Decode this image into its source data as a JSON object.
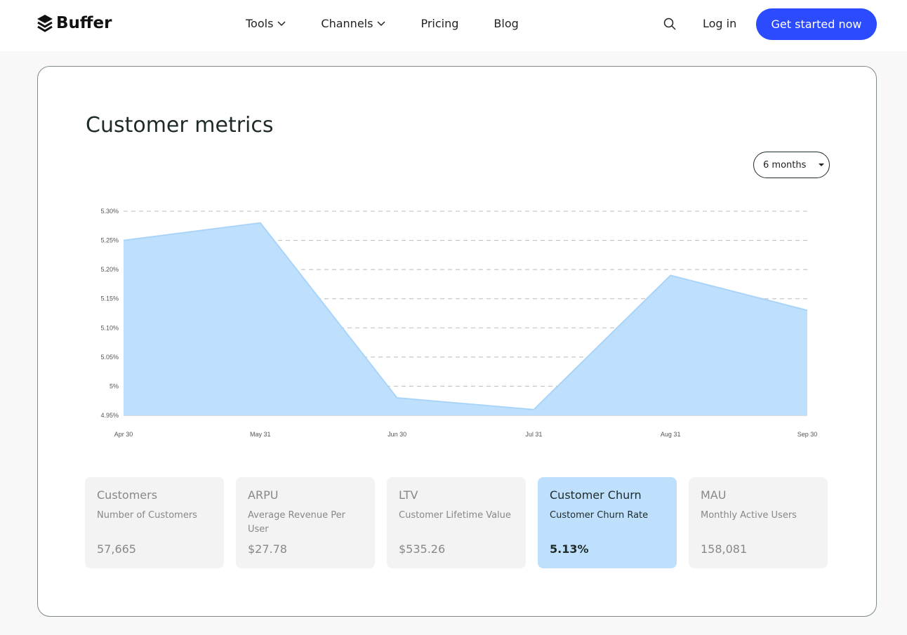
{
  "nav": {
    "brand": "Buffer",
    "links": [
      {
        "label": "Tools",
        "dropdown": true
      },
      {
        "label": "Channels",
        "dropdown": true
      },
      {
        "label": "Pricing"
      },
      {
        "label": "Blog"
      }
    ],
    "login": "Log in",
    "cta": "Get started now",
    "cta_color": "#2c4bff"
  },
  "main": {
    "title": "Customer metrics",
    "range": "6 months"
  },
  "chart_data": {
    "type": "area",
    "x": [
      "Apr 30",
      "May 31",
      "Jun 30",
      "Jul 31",
      "Aug 31",
      "Sep 30"
    ],
    "values": [
      5.25,
      5.28,
      4.98,
      4.96,
      5.19,
      5.13
    ],
    "yticks": [
      "5.30%",
      "5.25%",
      "5.20%",
      "5.15%",
      "5.10%",
      "5.05%",
      "5%",
      "4.95%"
    ],
    "ylim": [
      4.95,
      5.3
    ],
    "grid": true,
    "fill": "#bfe0fd"
  },
  "metrics": [
    {
      "title": "Customers",
      "desc": "Number of Customers",
      "value": "57,665"
    },
    {
      "title": "ARPU",
      "desc": "Average Revenue Per User",
      "value": "$27.78"
    },
    {
      "title": "LTV",
      "desc": "Customer Lifetime Value",
      "value": "$535.26"
    },
    {
      "title": "Customer Churn",
      "desc": "Customer Churn Rate",
      "value": "5.13%",
      "active": true
    },
    {
      "title": "MAU",
      "desc": "Monthly Active Users",
      "value": "158,081"
    }
  ]
}
